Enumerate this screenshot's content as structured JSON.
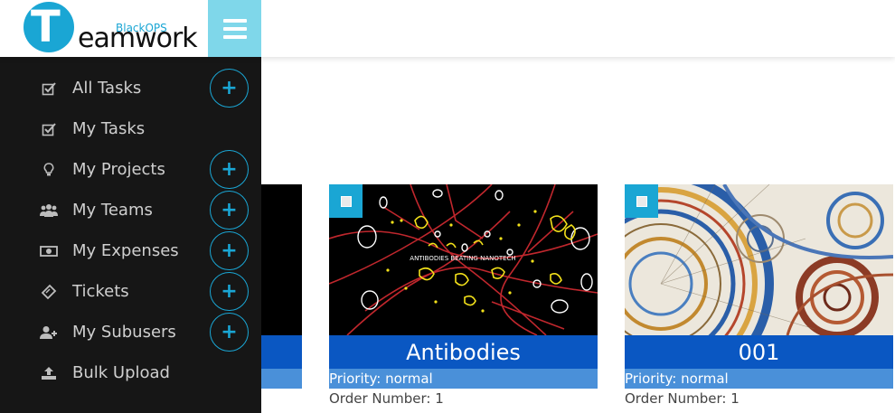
{
  "brand": {
    "logo_letter": "T",
    "logo_main": "eamwork",
    "logo_sub": "BlackOPS"
  },
  "sidebar": {
    "items": [
      {
        "label": "All Tasks",
        "icon": "check-square-icon",
        "has_add": true
      },
      {
        "label": "My Tasks",
        "icon": "check-square-icon",
        "has_add": false
      },
      {
        "label": "My Projects",
        "icon": "lightbulb-icon",
        "has_add": true
      },
      {
        "label": "My Teams",
        "icon": "users-icon",
        "has_add": true
      },
      {
        "label": "My Expenses",
        "icon": "money-icon",
        "has_add": true
      },
      {
        "label": "Tickets",
        "icon": "ticket-icon",
        "has_add": true
      },
      {
        "label": "My Subusers",
        "icon": "user-plus-icon",
        "has_add": true
      },
      {
        "label": "Bulk Upload",
        "icon": "upload-icon",
        "has_add": false
      }
    ],
    "add_symbol": "+"
  },
  "cards": [
    {
      "title": "",
      "priority": "",
      "order": ""
    },
    {
      "title": "Antibodies",
      "image_caption": "ANTIBODIES BEATING NANOTECH",
      "priority": "Priority: normal",
      "order": "Order Number: 1"
    },
    {
      "title": "001",
      "priority": "Priority: normal",
      "order": "Order Number: 1"
    }
  ],
  "colors": {
    "accent": "#1aa6d4",
    "card_title_bg": "#0a57c2",
    "card_priority_bg": "#4a90d9",
    "sidebar_bg": "#161616",
    "toggle_bg": "#7fd7ea"
  }
}
